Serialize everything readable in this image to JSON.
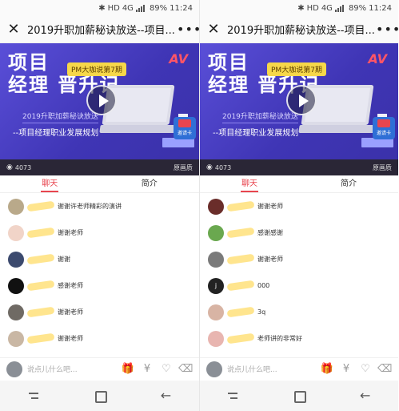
{
  "status": {
    "bluetooth": "✱",
    "hd": "HD",
    "net": "4G",
    "battery": "89%",
    "time": "11:24"
  },
  "app": {
    "title": "2019升职加薪秘诀放送--项目...",
    "close_icon": "close-icon",
    "more_icon": "more-icon"
  },
  "video": {
    "headline_line1": "项目",
    "headline_line2": "经理 晋升记",
    "badge": "PM大咖说第7期",
    "logo": "AV",
    "subtitle1": "2019升职加薪秘诀放送",
    "subtitle2": "--项目经理职业发展规划",
    "view_count": "4073",
    "quality": "原画质"
  },
  "tabs": {
    "chat": "聊天",
    "intro": "简介"
  },
  "left_messages": [
    {
      "text": "谢谢许老师精彩的演讲",
      "avatar": "#b9a98a"
    },
    {
      "text": "谢谢老师",
      "avatar": "#f1d4c8"
    },
    {
      "text": "谢谢",
      "avatar": "#3c4a6e"
    },
    {
      "text": "感谢老师",
      "avatar": "#111111"
    },
    {
      "text": "谢谢老师",
      "avatar": "#6f6a64"
    },
    {
      "text": "谢谢老师",
      "avatar": "#c9b7a4"
    }
  ],
  "right_messages": [
    {
      "text": "谢谢老师",
      "avatar": "#6a2d2a"
    },
    {
      "text": "感谢感谢",
      "avatar": "#6aa84f"
    },
    {
      "text": "谢谢老师",
      "avatar": "#7a7a7a"
    },
    {
      "text": "000",
      "avatar": "#222222",
      "letter": "j"
    },
    {
      "text": "3q",
      "avatar": "#d8b4a4"
    },
    {
      "text": "老师讲的非常好",
      "avatar": "#e8b5b0"
    }
  ],
  "gift": {
    "label": "邀请卡"
  },
  "input": {
    "placeholder": "说点儿什么吧..."
  },
  "toolbar_icons": [
    "gift-icon",
    "yuan-icon",
    "heart-icon",
    "clean-icon"
  ]
}
